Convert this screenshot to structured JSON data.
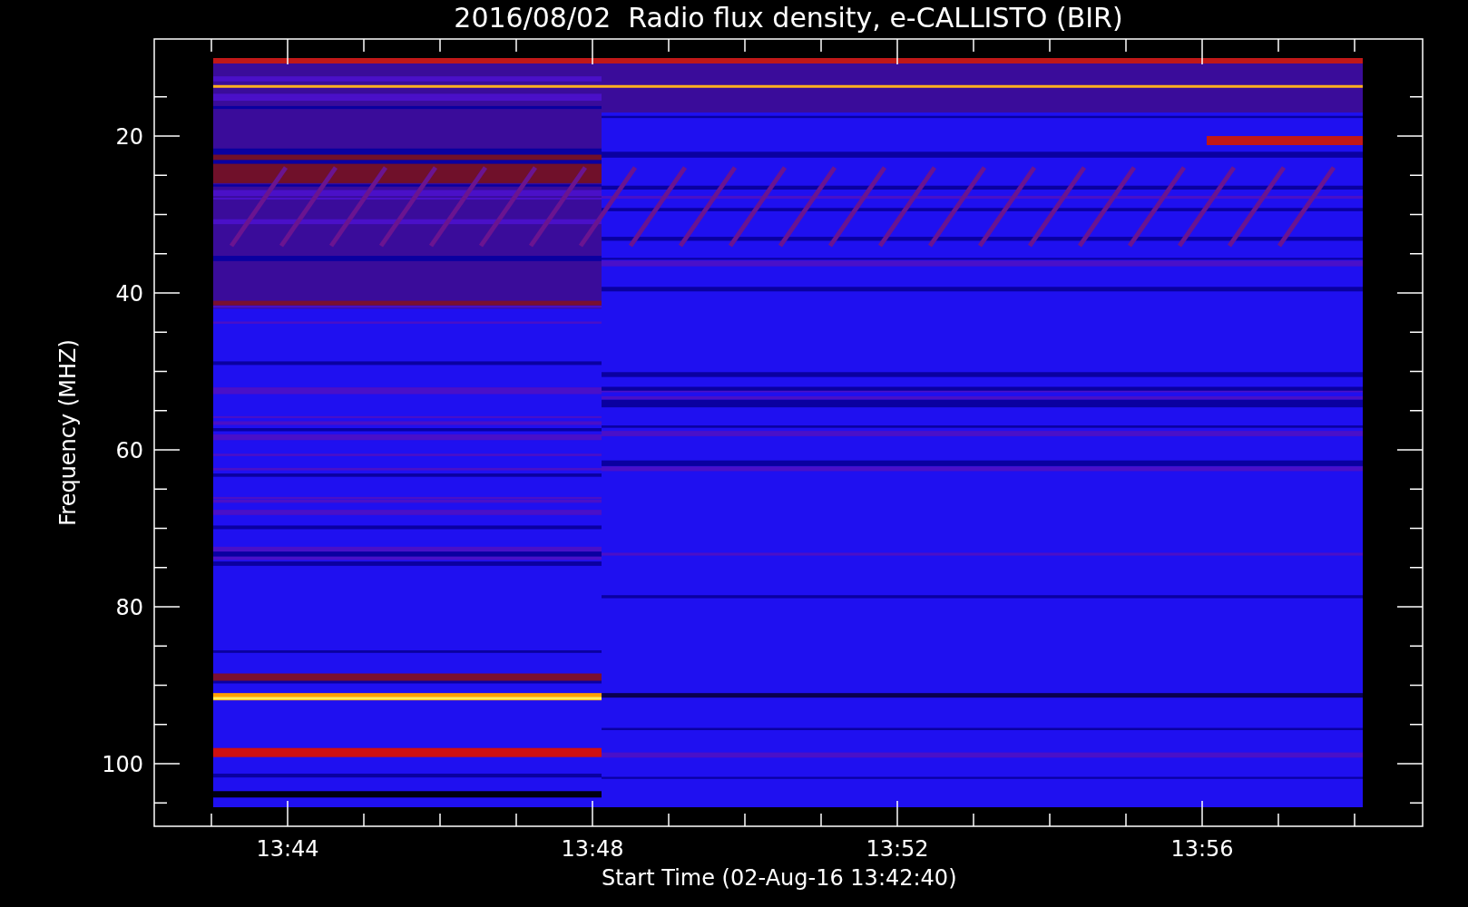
{
  "title": "2016/08/02  Radio flux density, e-CALLISTO (BIR)",
  "y_axis": {
    "label": "Frequency (MHZ)",
    "ticks": [
      "20",
      "40",
      "60",
      "80",
      "100"
    ]
  },
  "x_axis": {
    "label": "Start Time (02-Aug-16 13:42:40)",
    "ticks": [
      "13:44",
      "13:48",
      "13:52",
      "13:56"
    ]
  }
}
